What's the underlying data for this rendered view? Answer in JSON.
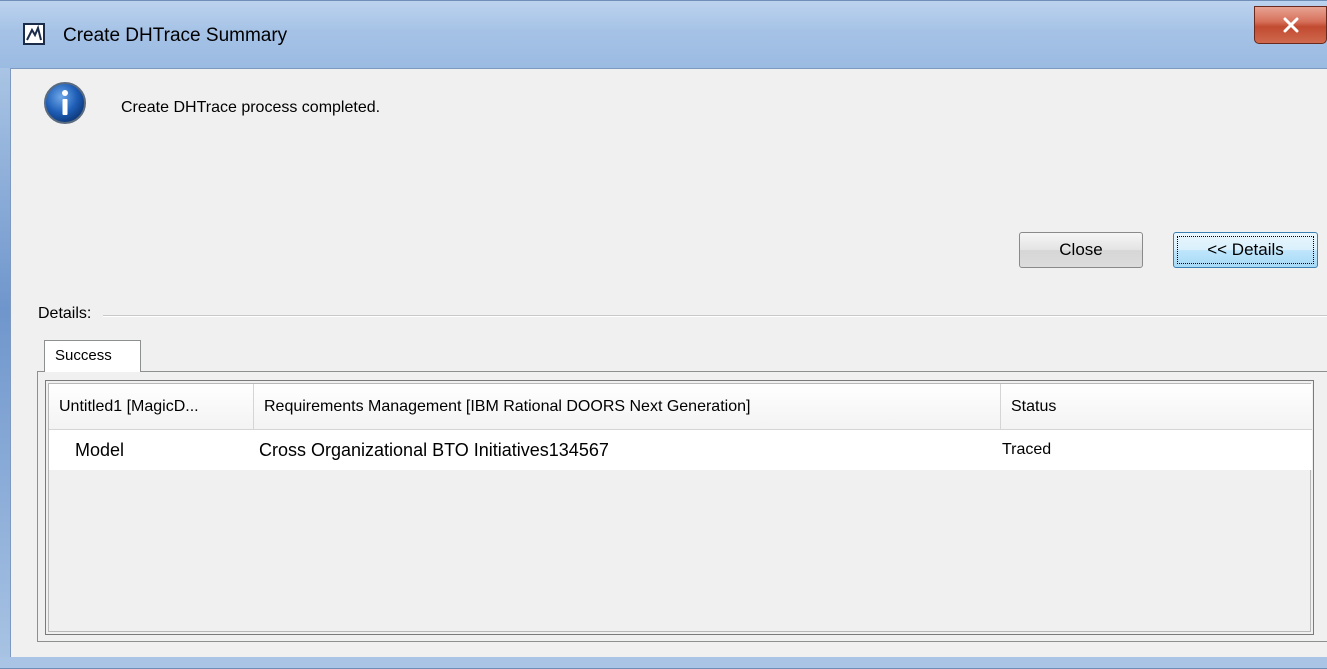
{
  "window": {
    "title": "Create DHTrace Summary",
    "close_label": "X"
  },
  "message": {
    "text": "Create DHTrace process completed."
  },
  "buttons": {
    "close_label": "Close",
    "details_label": "<< Details"
  },
  "details": {
    "label": "Details:",
    "tabs": [
      {
        "label": "Success"
      }
    ],
    "table": {
      "columns": [
        "Untitled1 [MagicD...",
        "Requirements Management [IBM Rational DOORS Next Generation]",
        "Status"
      ],
      "rows": [
        [
          "Model",
          "Cross Organizational BTO Initiatives134567",
          "Traced"
        ]
      ]
    }
  }
}
